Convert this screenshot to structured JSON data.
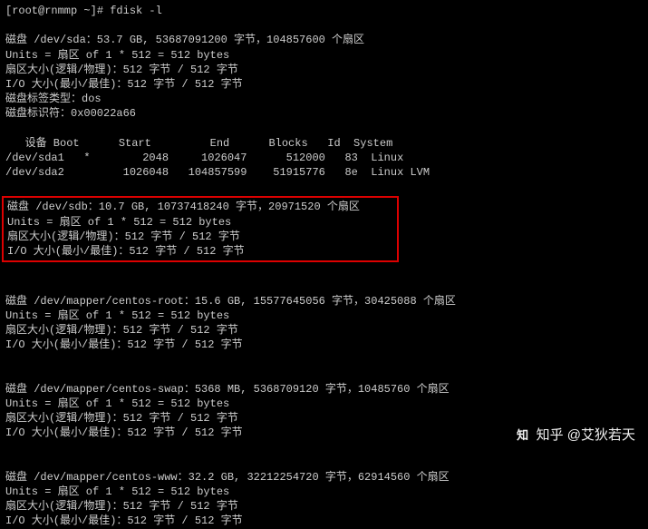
{
  "prompt": "[root@rnmmp ~]# fdisk -l",
  "sda": {
    "header": "磁盘 /dev/sda：53.7 GB, 53687091200 字节，104857600 个扇区",
    "units": "Units = 扇区 of 1 * 512 = 512 bytes",
    "sector": "扇区大小(逻辑/物理)：512 字节 / 512 字节",
    "io": "I/O 大小(最小/最佳)：512 字节 / 512 字节",
    "label": "磁盘标签类型：dos",
    "ident": "磁盘标识符：0x00022a66"
  },
  "part_table": {
    "head": "   设备 Boot      Start         End      Blocks   Id  System",
    "r1": "/dev/sda1   *        2048     1026047      512000   83  Linux",
    "r2": "/dev/sda2         1026048   104857599    51915776   8e  Linux LVM"
  },
  "sdb": {
    "header": "磁盘 /dev/sdb：10.7 GB, 10737418240 字节，20971520 个扇区",
    "units": "Units = 扇区 of 1 * 512 = 512 bytes",
    "sector": "扇区大小(逻辑/物理)：512 字节 / 512 字节",
    "io": "I/O 大小(最小/最佳)：512 字节 / 512 字节"
  },
  "mapper_root": {
    "header": "磁盘 /dev/mapper/centos-root：15.6 GB, 15577645056 字节，30425088 个扇区",
    "units": "Units = 扇区 of 1 * 512 = 512 bytes",
    "sector": "扇区大小(逻辑/物理)：512 字节 / 512 字节",
    "io": "I/O 大小(最小/最佳)：512 字节 / 512 字节"
  },
  "mapper_swap": {
    "header": "磁盘 /dev/mapper/centos-swap：5368 MB, 5368709120 字节，10485760 个扇区",
    "units": "Units = 扇区 of 1 * 512 = 512 bytes",
    "sector": "扇区大小(逻辑/物理)：512 字节 / 512 字节",
    "io": "I/O 大小(最小/最佳)：512 字节 / 512 字节"
  },
  "mapper_www": {
    "header": "磁盘 /dev/mapper/centos-www：32.2 GB, 32212254720 字节，62914560 个扇区",
    "units": "Units = 扇区 of 1 * 512 = 512 bytes",
    "sector": "扇区大小(逻辑/物理)：512 字节 / 512 字节",
    "io": "I/O 大小(最小/最佳)：512 字节 / 512 字节"
  },
  "watermark": {
    "logo": "知",
    "text": "知乎 @艾狄若天"
  }
}
